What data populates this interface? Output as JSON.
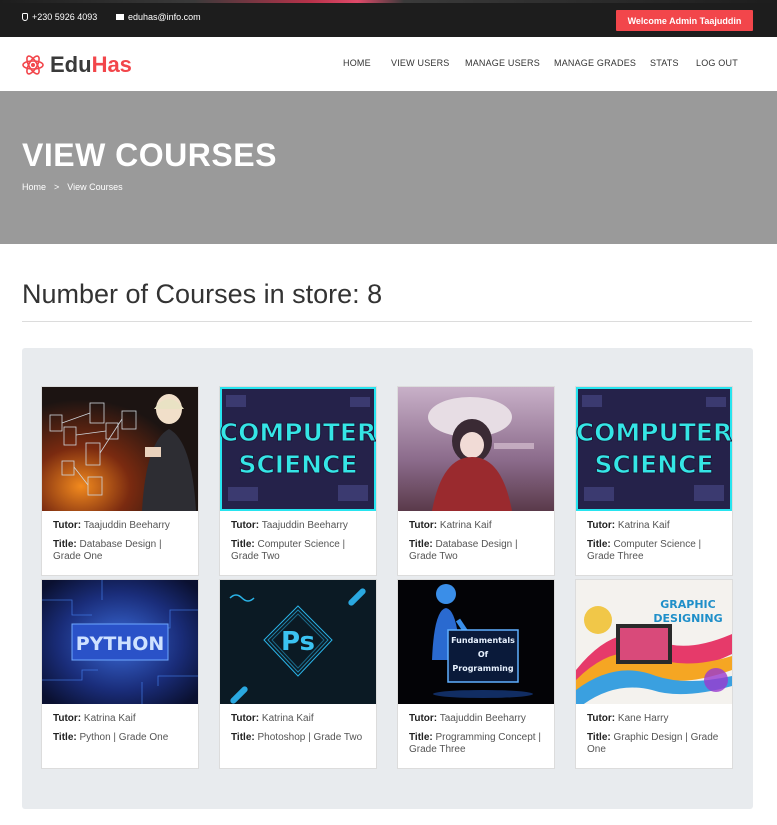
{
  "topbar": {
    "phone": "+230 5926 4093",
    "email": "eduhas@info.com",
    "welcome": "Welcome Admin Taajuddin"
  },
  "header": {
    "logo_left": "Edu",
    "logo_right": "Has",
    "nav": [
      "HOME",
      "VIEW USERS",
      "MANAGE USERS",
      "MANAGE GRADES",
      "STATS",
      "LOG OUT"
    ]
  },
  "hero": {
    "title": "VIEW COURSES",
    "breadcrumb": [
      "Home",
      ">",
      "View Courses"
    ]
  },
  "main": {
    "count_title": "Number of Courses in store: 8"
  },
  "labels": {
    "tutor": "Tutor:",
    "title": "Title:"
  },
  "courses": [
    {
      "tutor": "Taajuddin Beeharry",
      "title": "Database Design | Grade One",
      "image": "database-photo"
    },
    {
      "tutor": "Taajuddin Beeharry",
      "title": "Computer Science | Grade Two",
      "image": "computer-science-banner"
    },
    {
      "tutor": "Katrina Kaif",
      "title": "Database Design | Grade Two",
      "image": "anime-girl"
    },
    {
      "tutor": "Katrina Kaif",
      "title": "Computer Science | Grade Three",
      "image": "computer-science-banner"
    },
    {
      "tutor": "Katrina Kaif",
      "title": "Python | Grade One",
      "image": "python-circuit"
    },
    {
      "tutor": "Katrina Kaif",
      "title": "Photoshop | Grade Two",
      "image": "photoshop-logo"
    },
    {
      "tutor": "Taajuddin Beeharry",
      "title": "Programming Concept | Grade Three",
      "image": "fundamentals-of-programming"
    },
    {
      "tutor": "Kane Harry",
      "title": "Graphic Design | Grade One",
      "image": "graphic-designing"
    }
  ],
  "thumb_text": {
    "cs_line1": "COMPUTER",
    "cs_line2": "SCIENCE",
    "python": "PYTHON",
    "ps": "Ps",
    "fop1": "Fundamentals",
    "fop2": "Of",
    "fop3": "Programming",
    "gd1": "GRAPHIC",
    "gd2": "DESIGNING"
  },
  "colors": {
    "accent": "#f2464b",
    "topbar": "#1d1d1d",
    "hero": "#9a9a9a",
    "panel": "#e8ebee"
  }
}
